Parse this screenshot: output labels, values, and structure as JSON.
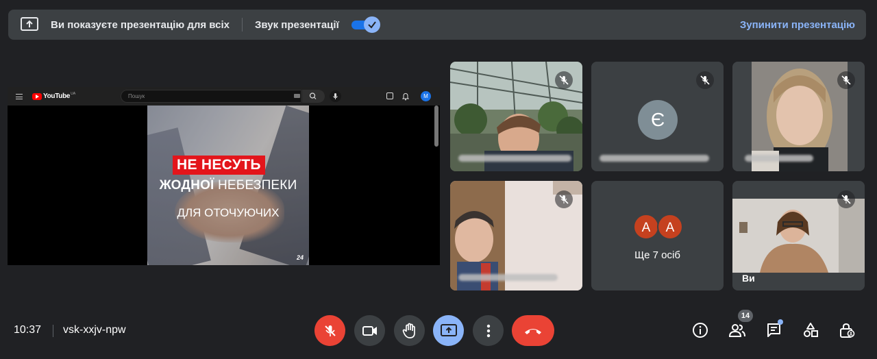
{
  "banner": {
    "message": "Ви показуєте презентацію для всіх",
    "sound_label": "Звук презентації",
    "sound_on": true,
    "stop_label": "Зупинити презентацію"
  },
  "presentation": {
    "youtube": {
      "logo_text": "YouTube",
      "region": "UA",
      "search_placeholder": "Пошук",
      "avatar_letter": "M"
    },
    "video": {
      "line1": "НЕ НЕСУТЬ",
      "line2_bold": "ЖОДНОЇ",
      "line2_rest": "НЕБЕЗПЕКИ",
      "line3": "ДЛЯ ОТОЧУЮЧИХ",
      "channel_logo": "24"
    }
  },
  "participants": [
    {
      "id": "p1",
      "name": "",
      "muted": true,
      "type": "video"
    },
    {
      "id": "p2",
      "name": "",
      "initial": "Є",
      "avatar_color": "#7f8e96",
      "muted": true,
      "type": "avatar"
    },
    {
      "id": "p3",
      "name": "",
      "muted": true,
      "type": "video"
    },
    {
      "id": "p4",
      "name": "",
      "muted": true,
      "type": "video"
    },
    {
      "id": "more",
      "avatars": [
        "А",
        "А"
      ],
      "label": "Ще 7 осіб"
    },
    {
      "id": "self",
      "name": "Ви",
      "muted": true,
      "type": "video"
    }
  ],
  "meeting": {
    "time": "10:37",
    "code": "vsk-xxjv-npw",
    "participant_count": "14"
  },
  "colors": {
    "accent": "#8ab4f8",
    "danger": "#ea4335",
    "surface": "#3c4043",
    "background": "#202124"
  }
}
